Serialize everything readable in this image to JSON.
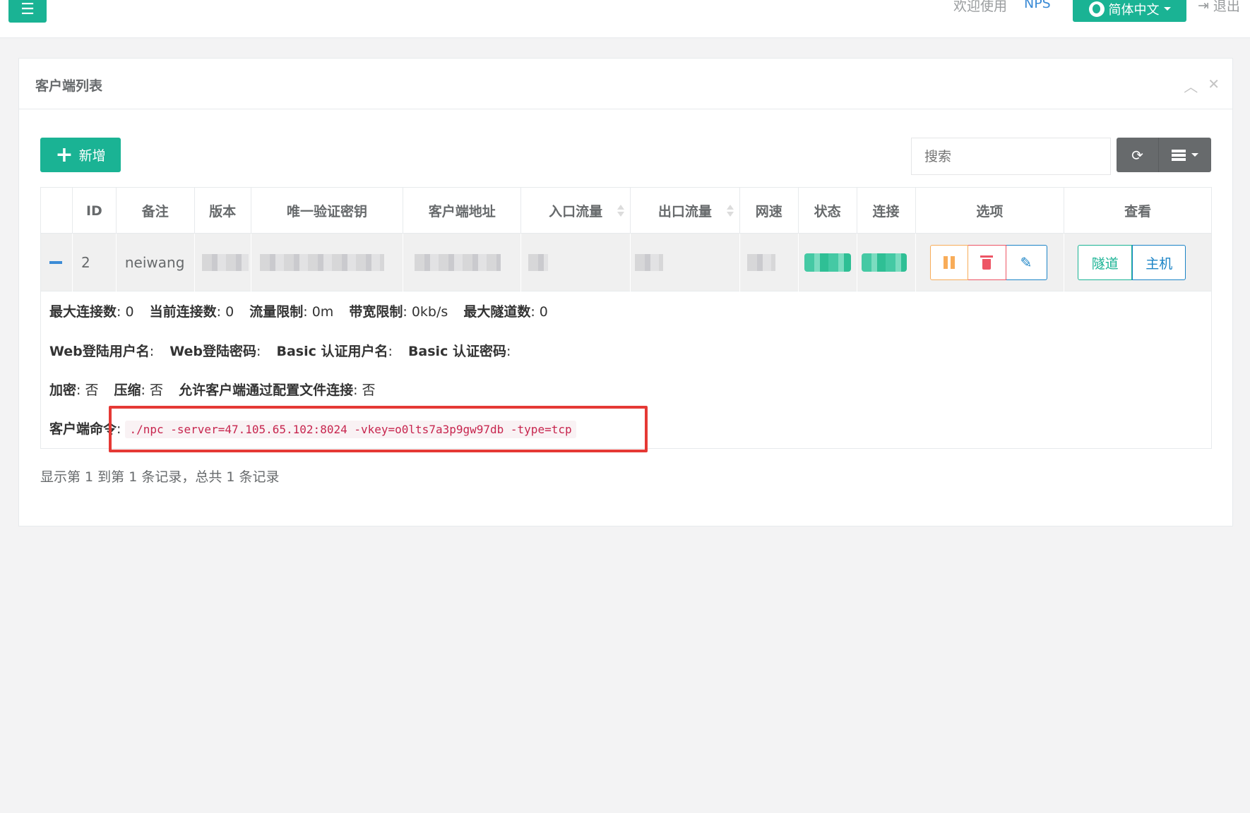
{
  "topbar": {
    "menu_icon": "☰",
    "welcome": "欢迎使用",
    "brand": "NPS",
    "language": "简体中文",
    "logout": "退出"
  },
  "panel": {
    "title": "客户端列表",
    "add_label": "新增",
    "search_placeholder": "搜索"
  },
  "table": {
    "headers": [
      "ID",
      "备注",
      "版本",
      "唯一验证密钥",
      "客户端地址",
      "入口流量",
      "出口流量",
      "网速",
      "状态",
      "连接",
      "选项",
      "查看"
    ],
    "row": {
      "id": "2",
      "remark": "neiwang",
      "view_tunnel": "隧道",
      "view_host": "主机"
    },
    "detail": {
      "max_conn_label": "最大连接数",
      "max_conn": "0",
      "cur_conn_label": "当前连接数",
      "cur_conn": "0",
      "flow_limit_label": "流量限制",
      "flow_limit": "0m",
      "bw_limit_label": "带宽限制",
      "bw_limit": "0kb/s",
      "max_tunnel_label": "最大隧道数",
      "max_tunnel": "0",
      "web_user_label": "Web登陆用户名",
      "web_pass_label": "Web登陆密码",
      "basic_user_label": "Basic 认证用户名",
      "basic_pass_label": "Basic 认证密码",
      "crypt_label": "加密",
      "crypt": "否",
      "compress_label": "压缩",
      "compress": "否",
      "config_conn_label": "允许客户端通过配置文件连接",
      "config_conn": "否",
      "command_label": "客户端命令",
      "command": "./npc -server=47.105.65.102:8024 -vkey=o0lts7a3p9gw97db -type=tcp"
    }
  },
  "pagination": {
    "info": "显示第 1 到第 1 条记录，总共 1 条记录"
  },
  "colors": {
    "primary": "#1ab394",
    "warning": "#f8ac59",
    "danger": "#ed5565",
    "info": "#1c84c6",
    "highlight": "#e53935"
  }
}
